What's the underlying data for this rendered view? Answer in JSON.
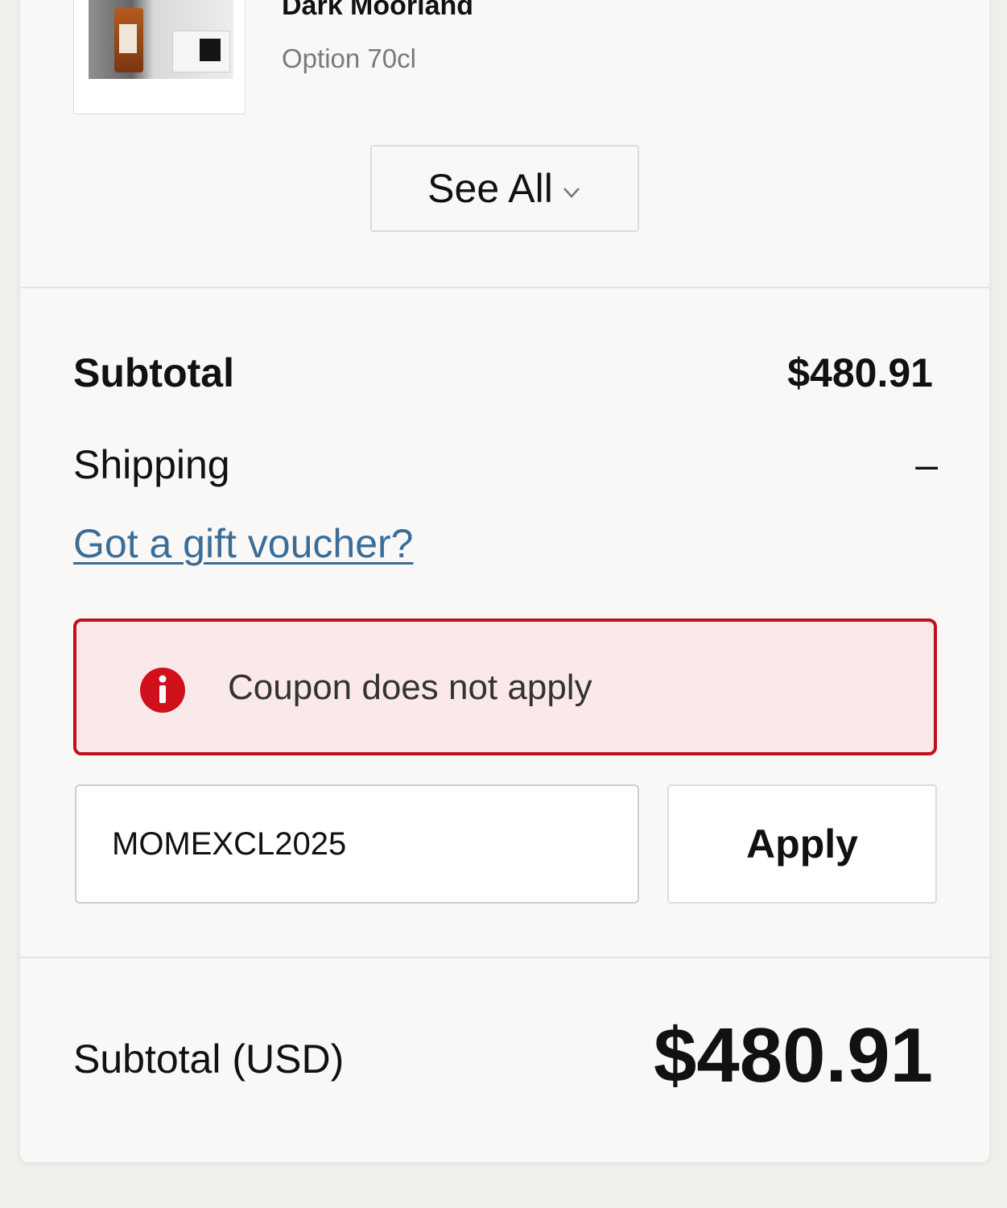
{
  "product": {
    "name": "Dark Moorland",
    "option": "Option 70cl"
  },
  "see_all": {
    "label": "See All"
  },
  "summary": {
    "subtotal_label": "Subtotal",
    "subtotal_value": "$480.91",
    "shipping_label": "Shipping",
    "shipping_value": "–"
  },
  "voucher": {
    "link_label": "Got a gift voucher?",
    "error_message": "Coupon does not apply",
    "input_value": "MOMEXCL2025",
    "apply_label": "Apply"
  },
  "footer": {
    "total_label": "Subtotal (USD)",
    "total_value": "$480.91"
  },
  "colors": {
    "error_border": "#c0101e",
    "error_background": "#fbe9ea",
    "link": "#3a6d99"
  }
}
